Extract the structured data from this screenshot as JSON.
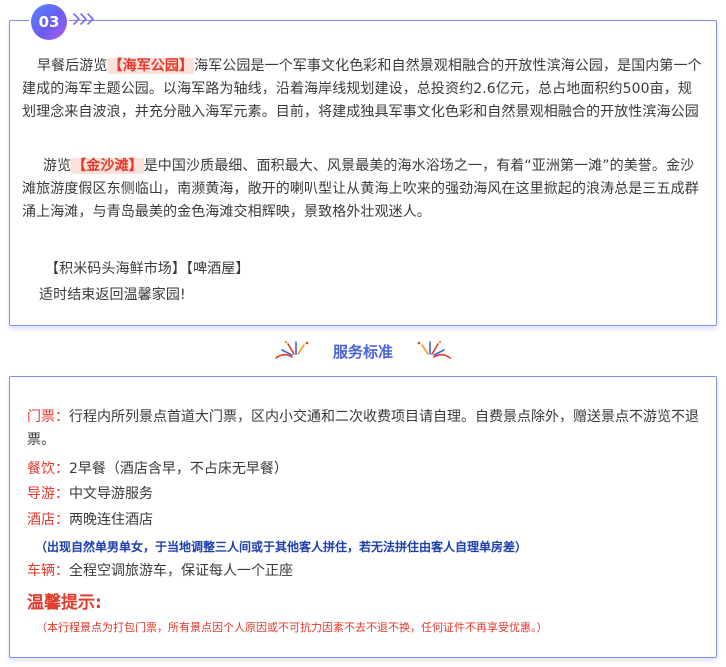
{
  "day": {
    "number": "03",
    "paragraphs": {
      "p1_pre": "早餐后游览",
      "p1_hl": "【海军公园】",
      "p1_post": "海军公园是一个军事文化色彩和自然景观相融合的开放性滨海公园，是国内第一个建成的海军主题公园。以海军路为轴线，沿着海岸线规划建设，总投资约2.6亿元，总占地面积约500亩，规划理念来自波浪，并充分融入海军元素。目前，将建成独具军事文化色彩和自然景观相融合的开放性滨海公园",
      "p2_pre": "游览",
      "p2_hl": "【金沙滩】",
      "p2_post": "是中国沙质最细、面积最大、风景最美的海水浴场之一，有着“亚洲第一滩”的美誉。金沙滩旅游度假区东侧临山，南濒黄海，敞开的喇叭型让从黄海上吹来的强劲海风在这里掀起的浪涛总是三五成群涌上海滩，与青岛最美的金色海滩交相辉映，景致格外壮观迷人。",
      "p3": "【积米码头海鲜市场】【啤酒屋】",
      "p4": "适时结束返回温馨家园!"
    }
  },
  "service": {
    "title": "服务标准",
    "items": [
      {
        "label": "门票：",
        "text": "行程内所列景点首道大门票，区内小交通和二次收费项目请自理。自费景点除外，赠送景点不游览不退票。"
      },
      {
        "label": "餐饮：",
        "text": "2早餐（酒店含早，不占床无早餐）"
      },
      {
        "label": "导游：",
        "text": "中文导游服务"
      },
      {
        "label": "酒店：",
        "text": "两晚连住酒店"
      }
    ],
    "hotel_note": "（出现自然单男单女，于当地调整三人间或于其他客人拼住，若无法拼住由客人自理单房差）",
    "vehicle": {
      "label": "车辆：",
      "text": "全程空调旅游车，保证每人一个正座"
    },
    "warm_title": "温馨提示:",
    "warm_note": "（本行程景点为打包门票，所有景点因个人原因或不可抗力因素不去不退不换，任何证件不再享受优惠。）"
  },
  "colors": {
    "accent_blue": "#4a63d8",
    "border_blue": "#7e8cf0",
    "highlight_red": "#e4392c",
    "note_blue": "#1f3fae"
  }
}
